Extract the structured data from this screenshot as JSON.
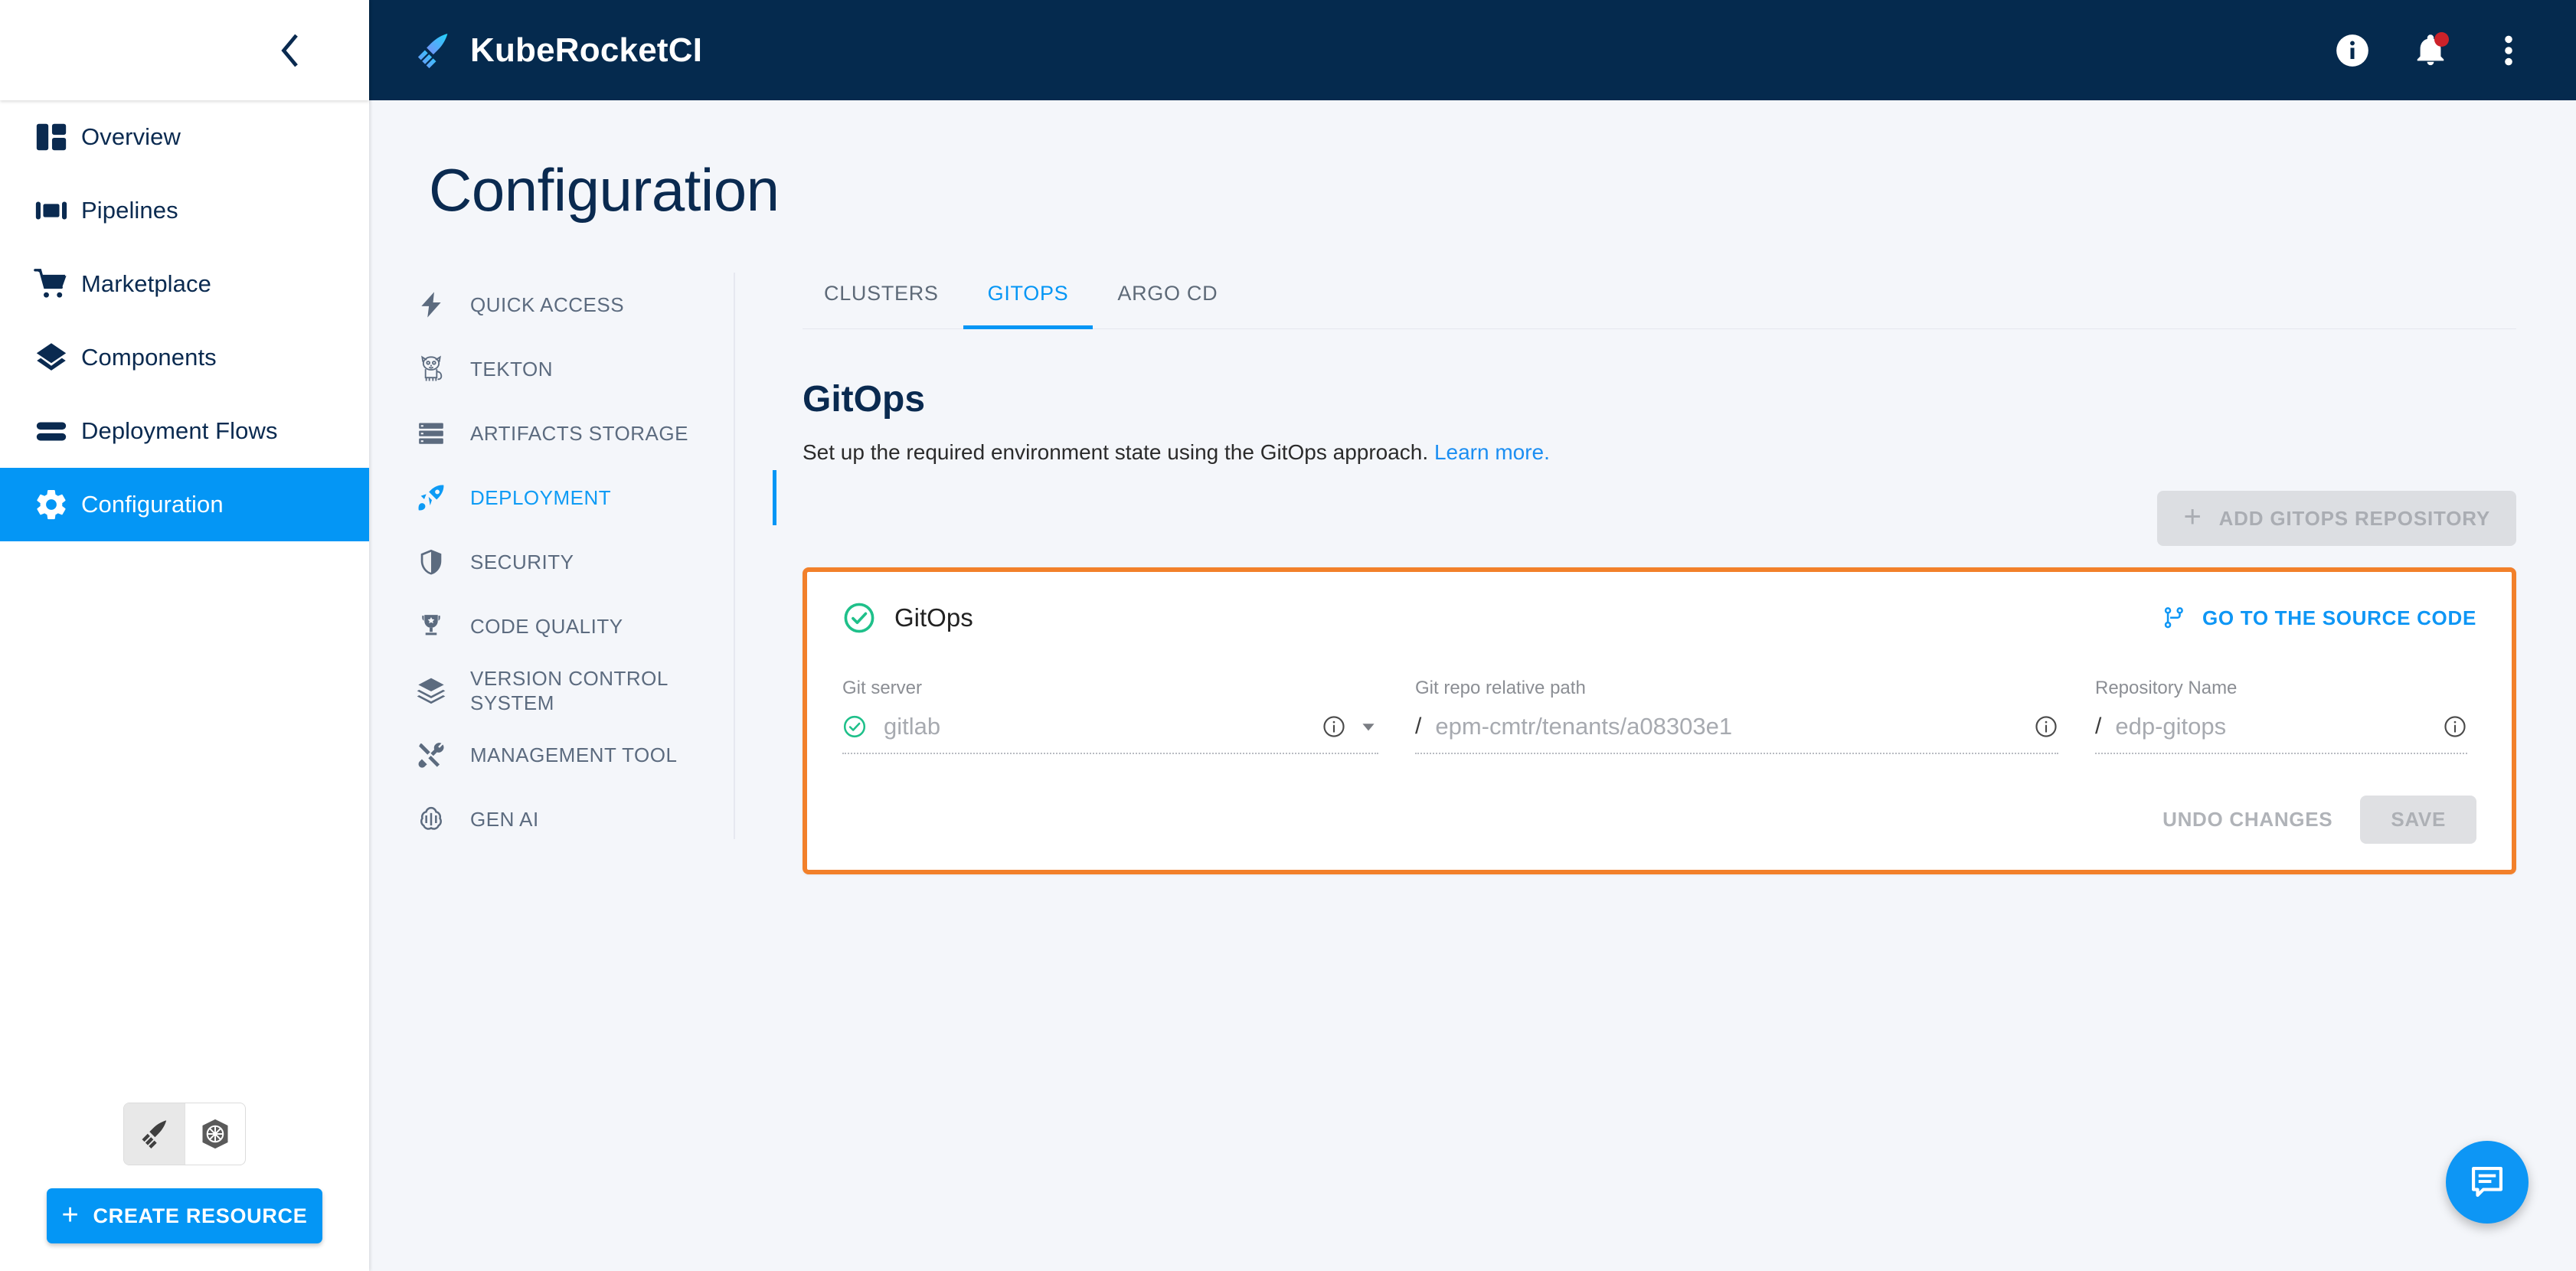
{
  "header": {
    "brand_title": "KubeRocketCI",
    "logo_icon": "rocket-feather-logo",
    "info_icon": "info-circle-icon",
    "notifications_icon": "bell-icon",
    "more_icon": "kebab-menu-icon",
    "notification_badge": true
  },
  "sidebar": {
    "collapse_icon": "chevron-left-icon",
    "items": [
      {
        "label": "Overview",
        "icon": "dashboard-icon",
        "active": false
      },
      {
        "label": "Pipelines",
        "icon": "pipelines-icon",
        "active": false
      },
      {
        "label": "Marketplace",
        "icon": "cart-icon",
        "active": false
      },
      {
        "label": "Components",
        "icon": "layers-diamond-icon",
        "active": false
      },
      {
        "label": "Deployment Flows",
        "icon": "stacked-bars-icon",
        "active": false
      },
      {
        "label": "Configuration",
        "icon": "gear-icon",
        "active": true
      }
    ],
    "mode_toggle": [
      {
        "icon": "kuberocketci-logo-icon",
        "selected": true
      },
      {
        "icon": "kubernetes-helm-icon",
        "selected": false
      }
    ],
    "create_button": {
      "label": "Create resource",
      "icon": "plus-icon"
    }
  },
  "page": {
    "title": "Configuration"
  },
  "subnav": {
    "items": [
      {
        "label": "Quick Access",
        "icon": "lightning-bolt-icon",
        "active": false
      },
      {
        "label": "Tekton",
        "icon": "tekton-cat-icon",
        "active": false
      },
      {
        "label": "Artifacts Storage",
        "icon": "server-rack-icon",
        "active": false
      },
      {
        "label": "Deployment",
        "icon": "rocket-icon",
        "active": true
      },
      {
        "label": "Security",
        "icon": "shield-icon",
        "active": false
      },
      {
        "label": "Code Quality",
        "icon": "trophy-icon",
        "active": false
      },
      {
        "label": "Version Control System",
        "icon": "layers-icon",
        "active": false
      },
      {
        "label": "Management Tool",
        "icon": "tools-icon",
        "active": false
      },
      {
        "label": "Gen AI",
        "icon": "openai-swirl-icon",
        "active": false
      }
    ]
  },
  "tabs": [
    {
      "label": "Clusters",
      "active": false
    },
    {
      "label": "GitOps",
      "active": true
    },
    {
      "label": "Argo CD",
      "active": false
    }
  ],
  "section": {
    "title": "GitOps",
    "description": "Set up the required environment state using the GitOps approach.",
    "learn_more": "Learn more.",
    "add_button": {
      "label": "Add GitOps Repository",
      "icon": "plus-icon"
    }
  },
  "gitops_card": {
    "status_icon": "check-circle-icon",
    "title": "GitOps",
    "source_link": {
      "label": "Go to the source code",
      "icon": "git-branch-icon"
    },
    "fields": [
      {
        "label": "Git server",
        "value": "gitlab",
        "prefix_icon": "check-circle-icon",
        "info_icon": "info-outline-icon",
        "dropdown_icon": "caret-down-icon",
        "prefix_slash": false
      },
      {
        "label": "Git repo relative path",
        "value": "epm-cmtr/tenants/a08303e1",
        "info_icon": "info-outline-icon",
        "prefix_slash": true
      },
      {
        "label": "Repository Name",
        "value": "edp-gitops",
        "info_icon": "info-outline-icon",
        "prefix_slash": true
      }
    ],
    "undo_label": "Undo changes",
    "save_label": "Save"
  },
  "fab": {
    "icon": "chat-bubble-icon"
  },
  "colors": {
    "header_bg": "#052a4e",
    "accent_blue": "#0496f5",
    "highlight_orange": "#f2802a",
    "success_green": "#1fc08a",
    "page_bg": "#f4f6fa",
    "notification_red": "#cc2229"
  }
}
